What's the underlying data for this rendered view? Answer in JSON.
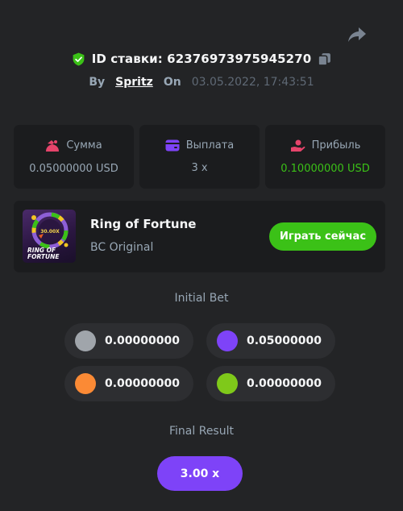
{
  "header": {
    "bet_id_label": "ID ставки: 62376973975945270",
    "by_label": "By",
    "username": "Spritz",
    "on_label": "On",
    "datetime": "03.05.2022, 17:43:51"
  },
  "stats": [
    {
      "label": "Сумма",
      "value": "0.05000000 USD",
      "icon": "money-bag-icon"
    },
    {
      "label": "Выплата",
      "value": "3 x",
      "icon": "wallet-icon"
    },
    {
      "label": "Прибыль",
      "value": "0.10000000 USD",
      "icon": "hand-coin-icon"
    }
  ],
  "game": {
    "name": "Ring of Fortune",
    "provider": "BC Original",
    "play_label": "Играть сейчас",
    "thumb_text_top": "RING OF",
    "thumb_text_bottom": "FORTUNE",
    "thumb_value": "30.00X"
  },
  "initial_bet": {
    "title": "Initial Bet",
    "chips": [
      {
        "color": "#a0a5ab",
        "value": "0.00000000"
      },
      {
        "color": "#7e43f8",
        "value": "0.05000000"
      },
      {
        "color": "#fb8a35",
        "value": "0.00000000"
      },
      {
        "color": "#7fc91a",
        "value": "0.00000000"
      }
    ]
  },
  "final_result": {
    "title": "Final Result",
    "value": "3.00 x"
  },
  "colors": {
    "background": "#232426",
    "panel": "#1b1c1e",
    "green": "#3bc117",
    "purple": "#7e43f8",
    "pink": "#e6446b"
  }
}
